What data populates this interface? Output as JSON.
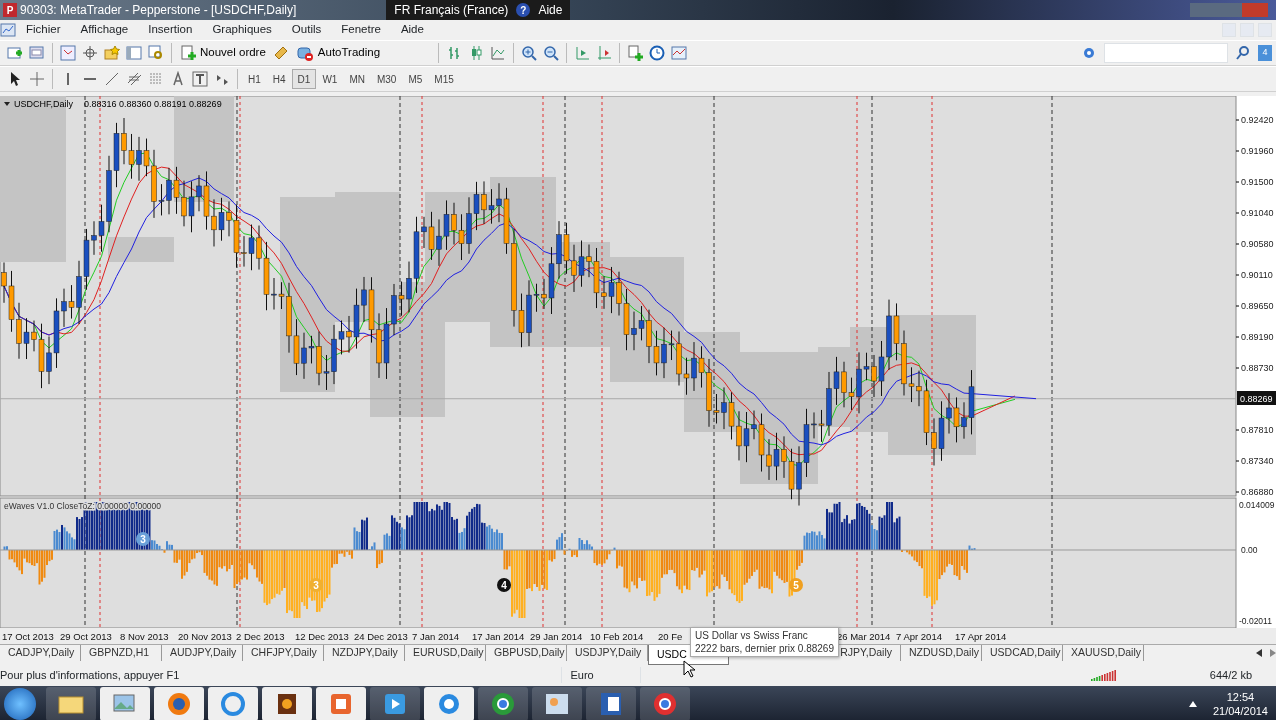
{
  "window": {
    "title": "90303: MetaTrader - Pepperstone - [USDCHF,Daily]",
    "app_icon": "P"
  },
  "language_bar": {
    "language": "FR Français (France)",
    "help_icon": "?",
    "help": "Aide"
  },
  "menu": [
    "Fichier",
    "Affichage",
    "Insertion",
    "Graphiques",
    "Outils",
    "Fenetre",
    "Aide"
  ],
  "toolbar": {
    "new_order": "Nouvel ordre",
    "autotrading": "AutoTrading",
    "notifications": "4"
  },
  "timeframes": [
    {
      "label": "H1",
      "selected": false
    },
    {
      "label": "H4",
      "selected": false
    },
    {
      "label": "D1",
      "selected": true
    },
    {
      "label": "W1",
      "selected": false
    },
    {
      "label": "MN",
      "selected": false
    },
    {
      "label": "M30",
      "selected": false
    },
    {
      "label": "M5",
      "selected": false
    },
    {
      "label": "M15",
      "selected": false
    }
  ],
  "chart": {
    "symbol": "USDCHF,Daily",
    "ohlc": "0.88316 0.88360 0.88191 0.88269",
    "price_axis": [
      "0.92420",
      "0.91960",
      "0.91500",
      "0.91040",
      "0.90580",
      "0.90110",
      "0.89650",
      "0.89190",
      "0.88730",
      "0.87810",
      "0.87340",
      "0.86880"
    ],
    "current_price": "0.88269"
  },
  "indicator": {
    "title": "eWaves V1.0 CloseToZ: 0.00000 0.00000",
    "axis": [
      "0.014009",
      "0.00",
      "-0.02011"
    ],
    "wave_labels": [
      "3",
      "3",
      "4",
      "5"
    ]
  },
  "dates": [
    "17 Oct 2013",
    "29 Oct 2013",
    "8 Nov 2013",
    "20 Nov 2013",
    "2 Dec 2013",
    "12 Dec 2013",
    "24 Dec 2013",
    "7 Jan 2014",
    "17 Jan 2014",
    "29 Jan 2014",
    "10 Feb 2014",
    "20 Fe",
    "26 Mar 2014",
    "7 Apr 2014",
    "17 Apr 2014"
  ],
  "tabs": [
    {
      "label": "CADJPY,Daily",
      "selected": false
    },
    {
      "label": "GBPNZD,H1",
      "selected": false
    },
    {
      "label": "AUDJPY,Daily",
      "selected": false
    },
    {
      "label": "CHFJPY,Daily",
      "selected": false
    },
    {
      "label": "NZDJPY,Daily",
      "selected": false
    },
    {
      "label": "EURUSD,Daily",
      "selected": false
    },
    {
      "label": "GBPUSD,Daily",
      "selected": false
    },
    {
      "label": "USDJPY,Daily",
      "selected": false
    },
    {
      "label": "USDC",
      "selected": true
    },
    {
      "label": "RJPY,Daily",
      "selected": false
    },
    {
      "label": "NZDUSD,Daily",
      "selected": false
    },
    {
      "label": "USDCAD,Daily",
      "selected": false
    },
    {
      "label": "XAUUSD,Daily",
      "selected": false
    }
  ],
  "tooltip": {
    "title": "US Dollar vs Swiss Franc",
    "text": "2222 bars, dernier prix 0.88269"
  },
  "status_bar": {
    "help": "Pour plus d'informations, appuyer F1",
    "profile": "Euro",
    "traffic": "644/2 kb"
  },
  "taskbar": {
    "time": "12:54",
    "date": "21/04/2014"
  }
}
